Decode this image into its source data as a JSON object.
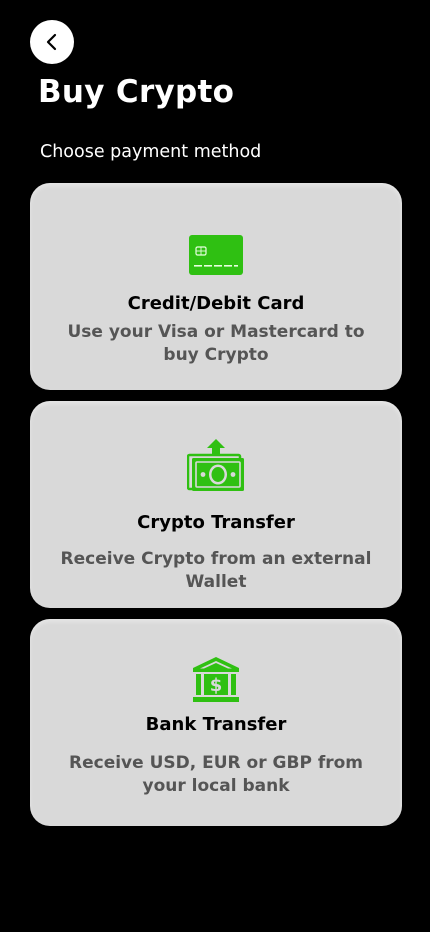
{
  "header": {
    "back_icon": "chevron-left-icon",
    "title": "Buy Crypto",
    "subtitle": "Choose payment method"
  },
  "accent_color": "#2fc012",
  "payment_methods": [
    {
      "icon": "credit-card-icon",
      "title": "Credit/Debit Card",
      "description": "Use your Visa or Mastercard to buy Crypto"
    },
    {
      "icon": "money-transfer-icon",
      "title": "Crypto Transfer",
      "description": "Receive Crypto from an external Wallet"
    },
    {
      "icon": "bank-icon",
      "title": "Bank Transfer",
      "description": "Receive USD, EUR or GBP from your local bank"
    }
  ]
}
